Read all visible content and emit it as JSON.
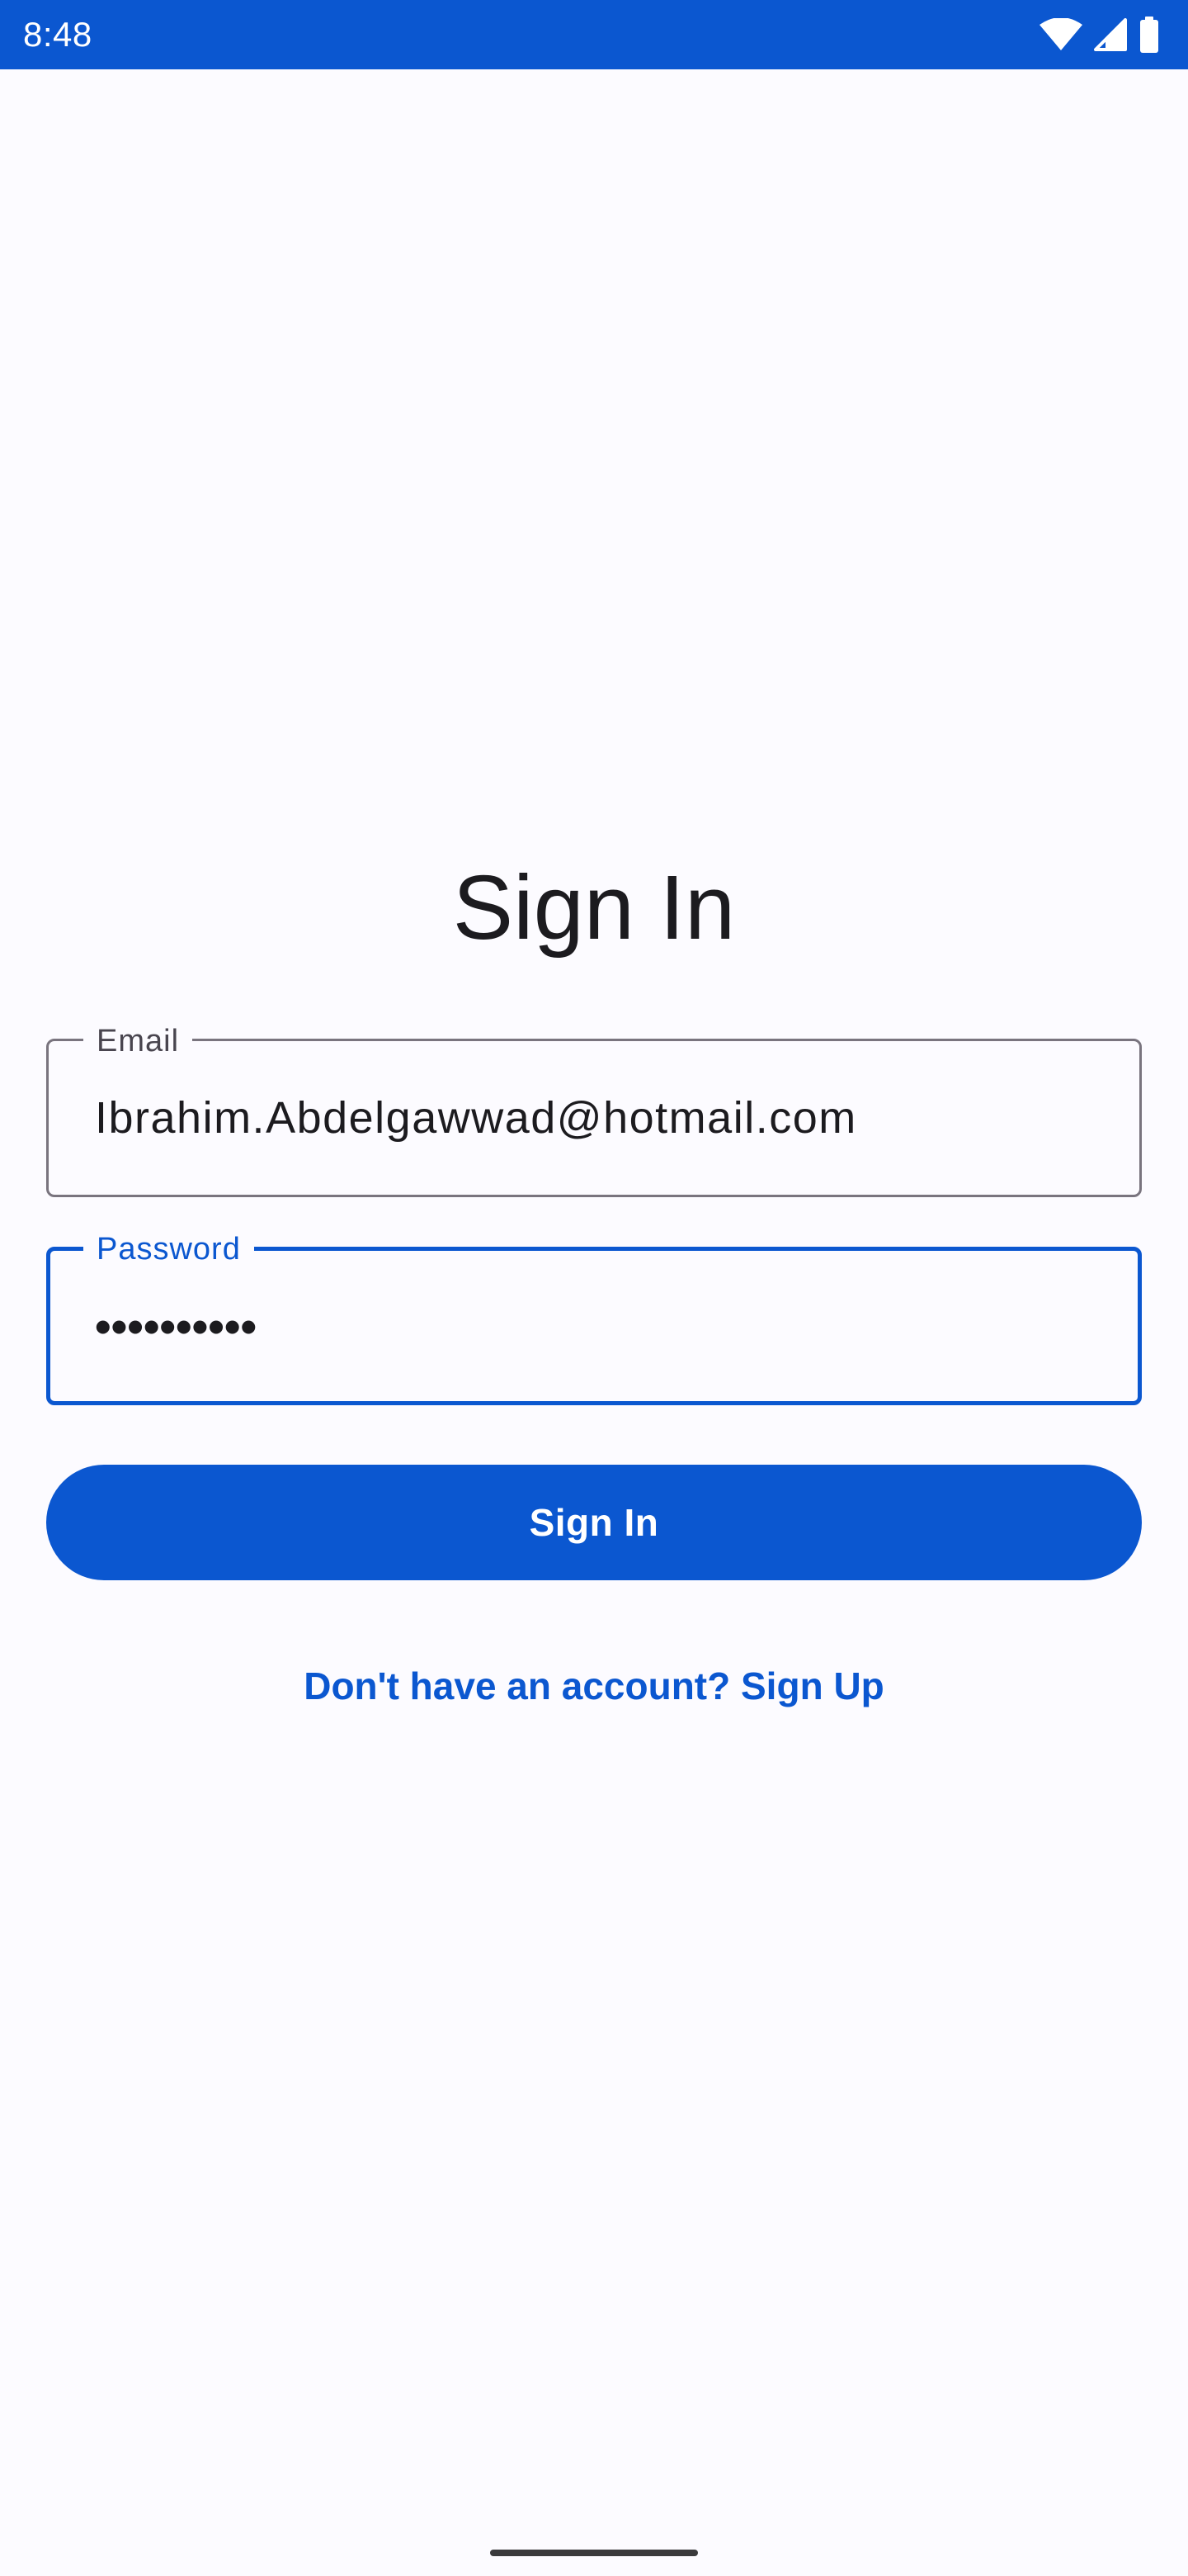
{
  "status_bar": {
    "time": "8:48",
    "icons": [
      "wifi-icon",
      "cellular-signal-icon",
      "battery-icon"
    ],
    "background_color": "#0b57d0"
  },
  "screen": {
    "title": "Sign In"
  },
  "form": {
    "email": {
      "label": "Email",
      "value": "Ibrahim.Abdelgawwad@hotmail.com"
    },
    "password": {
      "label": "Password",
      "value": "••••••••••",
      "focused": true
    },
    "signin_button_label": "Sign In",
    "signup_link_label": "Don't have an account? Sign Up"
  },
  "colors": {
    "accent": "#0b57d0",
    "background": "#fcfbff",
    "text": "#1c1b1f",
    "outline": "#79747e"
  }
}
